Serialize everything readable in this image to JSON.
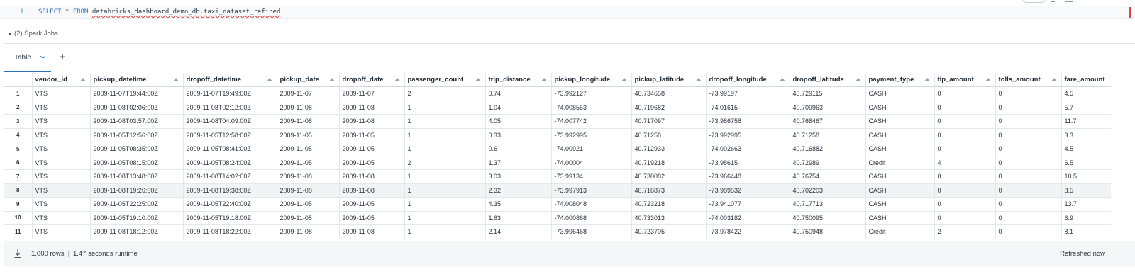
{
  "editor": {
    "line_number": "1",
    "keyword_select": "SELECT",
    "star": "*",
    "keyword_from": "FROM",
    "table_name": "databricks_dashboard_demo_db.taxi_dataset_refined"
  },
  "spark_jobs": {
    "label": "(2) Spark Jobs"
  },
  "results": {
    "tab_label": "Table",
    "columns": [
      "vendor_id",
      "pickup_datetime",
      "dropoff_datetime",
      "pickup_date",
      "dropoff_date",
      "passenger_count",
      "trip_distance",
      "pickup_longitude",
      "pickup_latitude",
      "dropoff_longitude",
      "dropoff_latitude",
      "payment_type",
      "tip_amount",
      "tolls_amount",
      "fare_amount"
    ],
    "rows": [
      [
        "1",
        "VTS",
        "2009-11-07T19:44:00Z",
        "2009-11-07T19:49:00Z",
        "2009-11-07",
        "2009-11-07",
        "2",
        "0.74",
        "-73.992127",
        "40.734658",
        "-73.99197",
        "40.729115",
        "CASH",
        "0",
        "0",
        "4.5"
      ],
      [
        "2",
        "VTS",
        "2009-11-08T02:06:00Z",
        "2009-11-08T02:12:00Z",
        "2009-11-08",
        "2009-11-08",
        "1",
        "1.04",
        "-74.008553",
        "40.719682",
        "-74.01615",
        "40.709963",
        "CASH",
        "0",
        "0",
        "5.7"
      ],
      [
        "3",
        "VTS",
        "2009-11-08T03:57:00Z",
        "2009-11-08T04:09:00Z",
        "2009-11-08",
        "2009-11-08",
        "1",
        "4.05",
        "-74.007742",
        "40.717097",
        "-73.986758",
        "40.768467",
        "CASH",
        "0",
        "0",
        "11.7"
      ],
      [
        "4",
        "VTS",
        "2009-11-05T12:56:00Z",
        "2009-11-05T12:58:00Z",
        "2009-11-05",
        "2009-11-05",
        "1",
        "0.33",
        "-73.992995",
        "40.71258",
        "-73.992995",
        "40.71258",
        "CASH",
        "0",
        "0",
        "3.3"
      ],
      [
        "5",
        "VTS",
        "2009-11-05T08:35:00Z",
        "2009-11-05T08:41:00Z",
        "2009-11-05",
        "2009-11-05",
        "1",
        "0.6",
        "-74.00921",
        "40.712933",
        "-74.002663",
        "40.716882",
        "CASH",
        "0",
        "0",
        "4.5"
      ],
      [
        "6",
        "VTS",
        "2009-11-05T08:15:00Z",
        "2009-11-05T08:24:00Z",
        "2009-11-05",
        "2009-11-05",
        "2",
        "1.37",
        "-74.00004",
        "40.719218",
        "-73.98615",
        "40.72989",
        "Credit",
        "4",
        "0",
        "6.5"
      ],
      [
        "7",
        "VTS",
        "2009-11-08T13:48:00Z",
        "2009-11-08T14:02:00Z",
        "2009-11-08",
        "2009-11-08",
        "1",
        "3.03",
        "-73.99134",
        "40.730082",
        "-73.966448",
        "40.76754",
        "CASH",
        "0",
        "0",
        "10.5"
      ],
      [
        "8",
        "VTS",
        "2009-11-08T19:26:00Z",
        "2009-11-08T19:38:00Z",
        "2009-11-08",
        "2009-11-08",
        "1",
        "2.32",
        "-73.997913",
        "40.716873",
        "-73.989532",
        "40.702203",
        "CASH",
        "0",
        "0",
        "8.5"
      ],
      [
        "9",
        "VTS",
        "2009-11-05T22:25:00Z",
        "2009-11-05T22:40:00Z",
        "2009-11-05",
        "2009-11-05",
        "1",
        "4.35",
        "-74.008048",
        "40.723218",
        "-73.941077",
        "40.717713",
        "CASH",
        "0",
        "0",
        "13.7"
      ],
      [
        "10",
        "VTS",
        "2009-11-05T19:10:00Z",
        "2009-11-05T19:18:00Z",
        "2009-11-05",
        "2009-11-05",
        "1",
        "1.63",
        "-74.000868",
        "40.733013",
        "-74.003182",
        "40.750095",
        "CASH",
        "0",
        "0",
        "6.9"
      ],
      [
        "11",
        "VTS",
        "2009-11-08T18:12:00Z",
        "2009-11-08T18:22:00Z",
        "2009-11-08",
        "2009-11-08",
        "1",
        "2.14",
        "-73.996468",
        "40.723705",
        "-73.978422",
        "40.750948",
        "Credit",
        "2",
        "0",
        "8.1"
      ]
    ],
    "highlighted_row": 8
  },
  "footer": {
    "rows_text": "1,000 rows",
    "runtime_text": "1.47 seconds runtime",
    "refreshed_text": "Refreshed now"
  },
  "colors": {
    "accent": "#2272b4",
    "error_underline": "#d63a3a"
  },
  "icons": [
    "caret-right-icon",
    "chevron-down-icon",
    "plus-icon",
    "sort-icon",
    "download-icon"
  ]
}
